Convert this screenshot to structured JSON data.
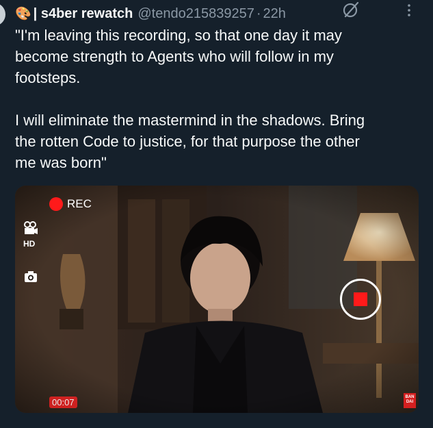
{
  "header": {
    "emoji": "🎨",
    "separator": "|",
    "display_name": "s4ber rewatch",
    "handle": "@tendo215839257",
    "dot": "·",
    "time": "22h"
  },
  "icons": {
    "grok": "grok-icon",
    "more": "more-icon",
    "video_camera": "video-camera-icon",
    "photo_camera": "photo-camera-icon"
  },
  "tweet": {
    "lines_1": [
      "\"I'm leaving this recording, so that one day it may",
      "become strength to Agents who will follow in my",
      "footsteps."
    ],
    "lines_2": [
      "I will eliminate the mastermind in the shadows. Bring",
      "the rotten Code to justice, for that purpose the other",
      "me was born\""
    ]
  },
  "media": {
    "rec_label": "REC",
    "hd_label": "HD",
    "timer": "00:07",
    "brand": "BAN DAI"
  },
  "colors": {
    "background": "#15202b",
    "text": "#f7f9f9",
    "muted": "#8b98a5",
    "rec_red": "#ff1a1a"
  }
}
